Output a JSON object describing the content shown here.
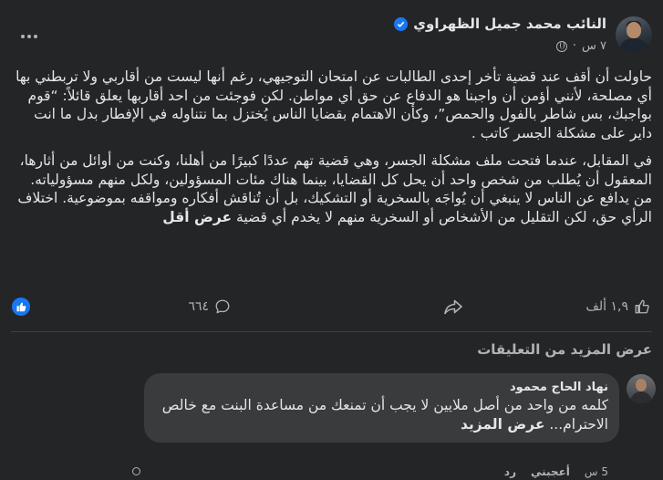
{
  "post": {
    "author_name": "النائب محمد جميل الظهراوي",
    "time": "٧ س",
    "separator": "·",
    "paragraphs": [
      "حاولت أن أقف عند قضية تأخر إحدى الطالبات عن امتحان التوجيهي، رغم أنها ليست من أقاربي ولا تربطني بها أي مصلحة، لأنني أؤمن أن واجبنا هو الدفاع عن حق أي مواطن. لكن فوجئت من احد أقاربها يعلق قائلاً: “قوم بواجبك، بس شاطر بالفول والحمص”، وكأن الاهتمام بقضايا الناس يُختزل بما نتناوله في الإفطار بدل ما انت داير على مشكلة الجسر كاتب .",
      "في المقابل، عندما فتحت ملف مشكلة الجسر، وهي قضية تهم عددًا كبيرًا من أهلنا، وكنت من أوائل من أثارها، المعقول أن يُطلب من شخص واحد أن يحل كل القضايا، بينما هناك مئات المسؤولين، ولكل منهم مسؤولياته. من يدافع عن الناس لا ينبغي أن يُواجَه بالسخرية أو التشكيك، بل أن تُناقش أفكاره ومواقفه بموضوعية. اختلاف الرأي حق، لكن التقليل من الأشخاص أو السخرية منهم لا يخدم أي قضية"
    ],
    "see_less": "عرض أقل"
  },
  "reactions": {
    "count": "١,٩ ألف",
    "comments": "٦٦٤"
  },
  "view_more_comments": "عرض المزيد من التعليقات",
  "comment": {
    "author": "نهاد الحاج محمود",
    "text": "كلمه من واحد من أصل ملايين لا يجب أن تمنعك من مساعدة البنت مع خالص الاحترام...",
    "see_more": "عرض المزيد",
    "time": "5 س",
    "like_label": "أعجبني",
    "reply_label": "رد"
  },
  "colors": {
    "background": "#242526",
    "bubble": "#3a3b3c",
    "accent": "#1877f2",
    "text_primary": "#e4e6eb",
    "text_secondary": "#b0b3b8"
  },
  "icons": {
    "verified": "verified-badge-icon",
    "audience": "globe-icon",
    "more": "more-options-icon",
    "like": "like-thumb-icon",
    "comment": "comment-bubble-icon",
    "share": "share-arrow-icon"
  }
}
